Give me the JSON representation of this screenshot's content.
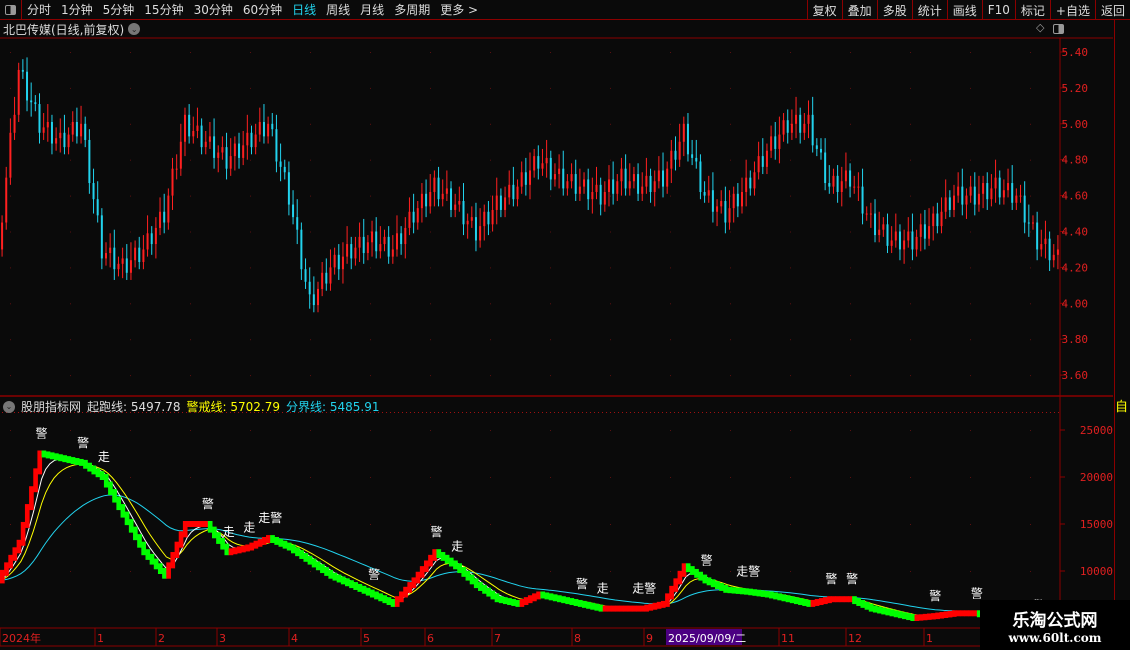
{
  "toolbar": {
    "periods": [
      "分时",
      "1分钟",
      "5分钟",
      "15分钟",
      "30分钟",
      "60分钟",
      "日线",
      "周线",
      "月线",
      "多周期",
      "更多 >"
    ],
    "active": "日线",
    "right_buttons": [
      "复权",
      "叠加",
      "多股",
      "统计",
      "画线",
      "F10",
      "标记",
      "+自选",
      "返回"
    ]
  },
  "stock": {
    "title": "北巴传媒(日线,前复权)"
  },
  "price_axis": {
    "ticks": [
      "5.40",
      "5.20",
      "5.00",
      "4.80",
      "4.60",
      "4.40",
      "4.20",
      "4.00",
      "3.80",
      "3.60"
    ],
    "range": [
      3.5,
      5.5
    ]
  },
  "indicator": {
    "name": "股朋指标网",
    "start_label": "起跑线:",
    "start_value": "5497.78",
    "warn_label": "警戒线:",
    "warn_value": "5702.79",
    "divide_label": "分界线:",
    "divide_value": "5485.91",
    "ticks": [
      "25000",
      "20000",
      "15000",
      "10000"
    ]
  },
  "date_axis": [
    "2024年",
    "1",
    "2",
    "3",
    "4",
    "5",
    "6",
    "7",
    "8",
    "9",
    "11",
    "12",
    "1"
  ],
  "cursor_date": "2025/09/09/二",
  "right_panel": {
    "highlight": "自"
  },
  "watermark": {
    "line1": "乐淘公式网",
    "line2": "www.60lt.com"
  },
  "colors": {
    "up": "#ff2020",
    "down": "#22d3ee",
    "ind_up": "#ff0000",
    "ind_down": "#00ff00",
    "fast": "#ffffff",
    "mid": "#ffff00",
    "slow": "#22d3ee",
    "axis": "#8b0000",
    "cursor_bg": "#4b0082"
  },
  "chart_data": {
    "type": "candlestick+line",
    "price_closes_approx": [
      4.3,
      5.3,
      5.0,
      4.9,
      5.0,
      4.3,
      4.2,
      4.3,
      4.5,
      5.0,
      4.9,
      4.8,
      4.9,
      5.0,
      4.6,
      4.0,
      4.2,
      4.3,
      4.35,
      4.3,
      4.5,
      4.65,
      4.55,
      4.4,
      4.55,
      4.65,
      4.8,
      4.7,
      4.65,
      4.6,
      4.7,
      4.65,
      4.7,
      4.95,
      4.6,
      4.5,
      4.65,
      4.85,
      5.0,
      5.0,
      4.65,
      4.7,
      4.45,
      4.35,
      4.35,
      4.45,
      4.6,
      4.6,
      4.65,
      4.6,
      4.35,
      4.25
    ],
    "indicator_values_approx": [
      9000,
      13000,
      22500,
      22000,
      21500,
      20000,
      16000,
      12000,
      9500,
      15000,
      15000,
      12000,
      12500,
      13500,
      12500,
      11000,
      9500,
      8500,
      7500,
      6500,
      9000,
      12000,
      10500,
      8500,
      7000,
      6500,
      7500,
      7000,
      6500,
      6000,
      6000,
      6000,
      6500,
      10500,
      9000,
      8000,
      7800,
      7500,
      7000,
      6500,
      7000,
      7000,
      6000,
      5500,
      5000,
      5200,
      5500,
      5500,
      5000,
      4500,
      4200,
      4000
    ],
    "indicator_range": [
      3000,
      28000
    ],
    "signals": [
      {
        "i": 2,
        "text": "警"
      },
      {
        "i": 4,
        "text": "警"
      },
      {
        "i": 5,
        "text": "走"
      },
      {
        "i": 10,
        "text": "警"
      },
      {
        "i": 11,
        "text": "走"
      },
      {
        "i": 12,
        "text": "走"
      },
      {
        "i": 13,
        "text": "走警"
      },
      {
        "i": 18,
        "text": "警"
      },
      {
        "i": 21,
        "text": "警"
      },
      {
        "i": 22,
        "text": "走"
      },
      {
        "i": 28,
        "text": "警"
      },
      {
        "i": 29,
        "text": "走"
      },
      {
        "i": 31,
        "text": "走警"
      },
      {
        "i": 34,
        "text": "警"
      },
      {
        "i": 36,
        "text": "走警"
      },
      {
        "i": 40,
        "text": "警"
      },
      {
        "i": 41,
        "text": "警"
      },
      {
        "i": 45,
        "text": "警"
      },
      {
        "i": 47,
        "text": "警"
      },
      {
        "i": 50,
        "text": "警"
      }
    ]
  }
}
